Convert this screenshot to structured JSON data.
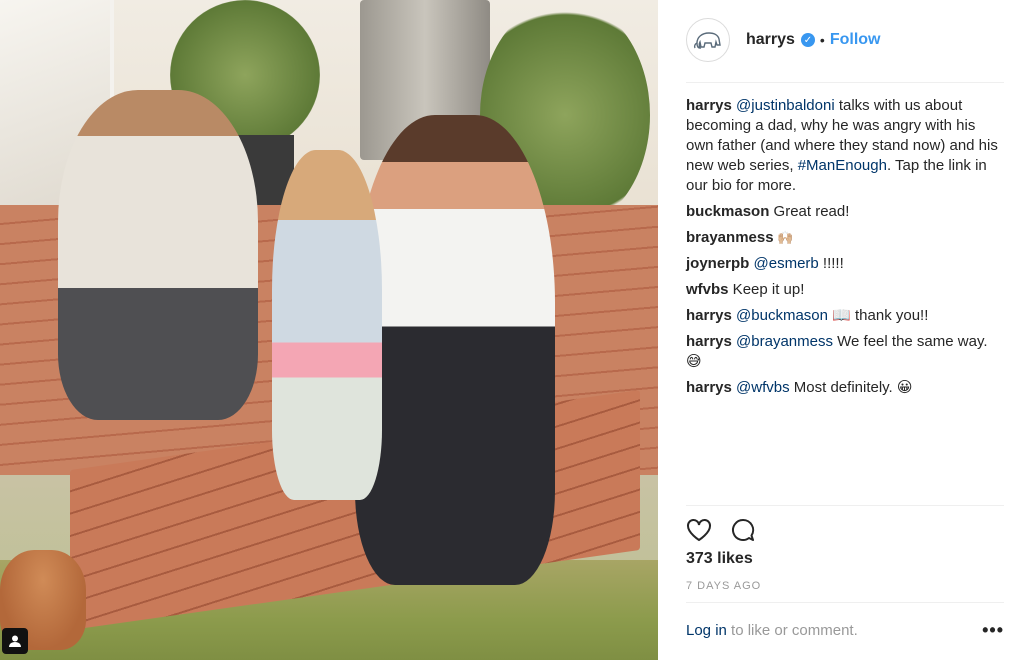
{
  "post": {
    "username": "harrys",
    "verified_glyph": "✓",
    "separator": "•",
    "follow_label": "Follow",
    "avatar_icon": "mammoth-icon"
  },
  "caption": {
    "user": "harrys",
    "mention": "@justinbaldoni",
    "text_1": " talks with us about becoming a dad, why he was angry with his own father (and where they stand now) and his new web series, ",
    "hashtag": "#ManEnough",
    "text_2": ". Tap the link in our bio for more."
  },
  "comments": [
    {
      "user": "buckmason",
      "mention": "",
      "text": " Great read!"
    },
    {
      "user": "brayanmess",
      "mention": "",
      "text": " 🙌🏼"
    },
    {
      "user": "joynerpb",
      "mention": "@esmerb",
      "text": " !!!!!"
    },
    {
      "user": "wfvbs",
      "mention": "",
      "text": " Keep it up!"
    },
    {
      "user": "harrys",
      "mention": "@buckmason",
      "text": " 📖  thank you!!"
    },
    {
      "user": "harrys",
      "mention": "@brayanmess",
      "text": " We feel the same way. 😅"
    },
    {
      "user": "harrys",
      "mention": "@wfvbs",
      "text": " Most definitely. 😀"
    }
  ],
  "stats": {
    "likes": "373 likes",
    "date": "7 DAYS AGO"
  },
  "footer": {
    "login_link": "Log in",
    "login_text": " to like or comment.",
    "more": "•••"
  },
  "icons": {
    "heart": "heart-icon",
    "comment": "comment-icon",
    "photo_user": "user-icon"
  },
  "colors": {
    "link_blue": "#3897f0",
    "mention_dark_blue": "#003569",
    "muted_gray": "#999999"
  }
}
